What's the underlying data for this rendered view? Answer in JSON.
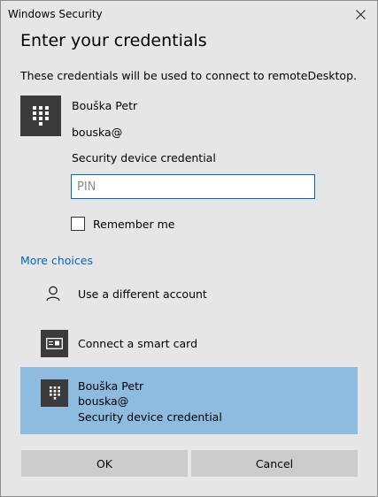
{
  "window": {
    "title": "Windows Security"
  },
  "heading": "Enter your credentials",
  "description": "These credentials will be used to connect to remoteDesktop.",
  "account": {
    "icon": "keypad-icon",
    "name": "Bouška Petr",
    "username": "bouska@",
    "credential_type": "Security device credential"
  },
  "pin_field": {
    "value": "",
    "placeholder": "PIN"
  },
  "remember_me": {
    "label": "Remember me",
    "checked": false
  },
  "more_choices": {
    "label": "More choices",
    "options": [
      {
        "icon": "person-icon",
        "label": "Use a different account"
      },
      {
        "icon": "smart-card-icon",
        "label": "Connect a smart card"
      },
      {
        "icon": "keypad-icon",
        "name": "Bouška Petr",
        "username": "bouska@",
        "type": "Security device credential",
        "selected": true
      }
    ]
  },
  "buttons": {
    "ok": "OK",
    "cancel": "Cancel"
  },
  "colors": {
    "accent": "#0067c0",
    "selected_bg": "#8ebbe0",
    "tile_bg": "#3b3b3b",
    "dialog_bg": "#e6e6e6"
  }
}
